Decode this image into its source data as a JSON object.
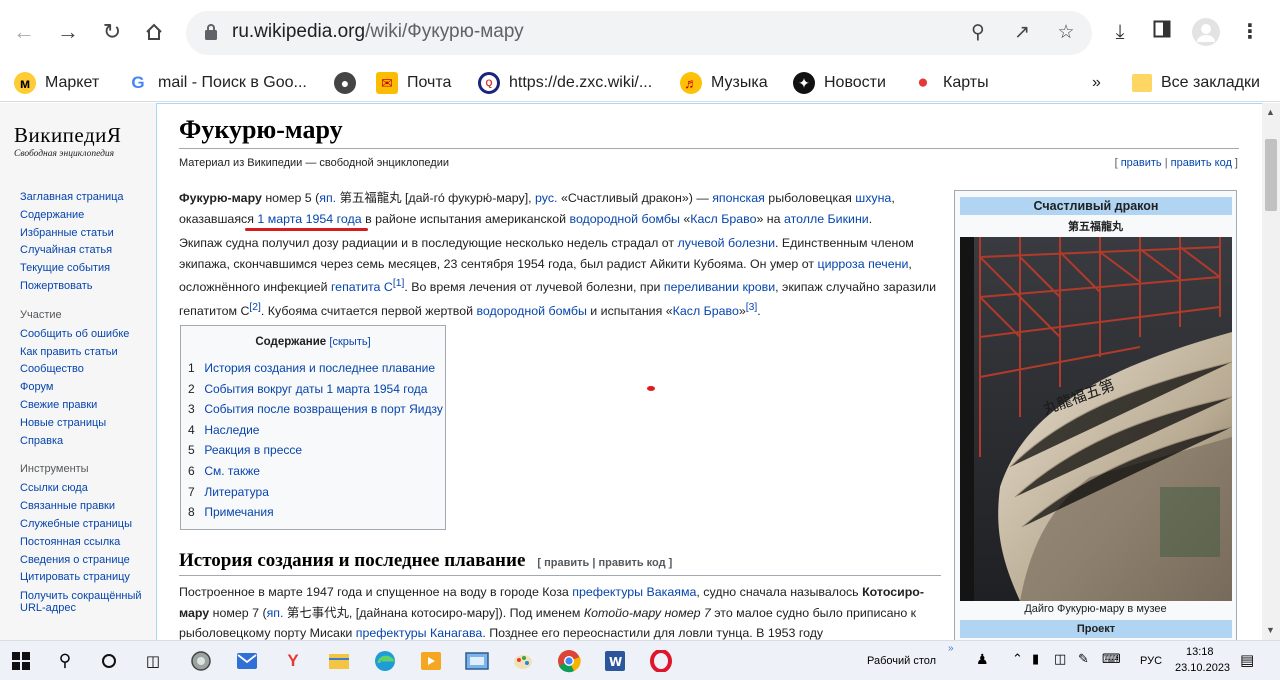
{
  "browser": {
    "url_domain": "ru.wikipedia.org",
    "url_path": "/wiki/Фукурю-мару",
    "bookmarks": [
      "Маркет",
      "mail - Поиск в Goo...",
      "Почта",
      "https://de.zxc.wiki/...",
      "Музыка",
      "Новости",
      "Карты"
    ],
    "more": "»",
    "all_bookmarks": "Все закладки"
  },
  "logo": {
    "name": "ВикипедиЯ",
    "subtitle": "Свободная энциклопедия"
  },
  "sidebar": {
    "nav": [
      "Заглавная страница",
      "Содержание",
      "Избранные статьи",
      "Случайная статья",
      "Текущие события",
      "Пожертвовать"
    ],
    "participation_head": "Участие",
    "participation": [
      "Сообщить об ошибке",
      "Как править статьи",
      "Сообщество",
      "Форум",
      "Свежие правки",
      "Новые страницы",
      "Справка"
    ],
    "tools_head": "Инструменты",
    "tools": [
      "Ссылки сюда",
      "Связанные правки",
      "Служебные страницы",
      "Постоянная ссылка",
      "Сведения о странице",
      "Цитировать страницу",
      "Получить сокращённый URL-адрес"
    ]
  },
  "article": {
    "title": "Фукурю-мару",
    "tagline": "Материал из Википедии — свободной энциклопедии",
    "edit": "править",
    "edit_code": "править код",
    "p1": {
      "bold": "Фукурю-мару",
      "t1": " номер 5 (",
      "l1": "яп.",
      "t2": " 第五福龍丸 [дай-го́ фукурю́-мару], ",
      "l2": "рус.",
      "t3": " «Счастливый дракон») — ",
      "l3": "японская",
      "t4": " рыболовецкая ",
      "l4": "шхуна",
      "t5": ", оказавшаяся ",
      "l5": "1 марта 1954 года",
      "t6": " в районе испытания американской ",
      "l6": "водородной бомбы",
      "t7": " «",
      "l7": "Касл Браво",
      "t8": "» на ",
      "l8": "атолле Бикини",
      "t9": "."
    },
    "p2": {
      "t1": "Экипаж судна получил дозу радиации и в последующие несколько недель страдал от ",
      "l1": "лучевой болезни",
      "t2": ". Единственным членом экипажа, скончавшимся через семь месяцев, 23 сентября 1954 года, был радист Айкити Кубояма. Он умер от ",
      "l2": "цирроза печени",
      "t3": ", осложнённого инфекцией ",
      "l3": "гепатита C",
      "r1": "[1]",
      "t4": ". Во время лечения от лучевой болезни, при ",
      "l4": "переливании крови",
      "t5": ", экипаж случайно заразили гепатитом С",
      "r2": "[2]",
      "t6": ". Кубояма считается первой жертвой ",
      "l5": "водородной бомбы",
      "t7": " и испытания «",
      "l6": "Касл Браво",
      "t8": "»",
      "r3": "[3]",
      "t9": "."
    },
    "toc": {
      "title": "Содержание",
      "hide": "[скрыть]",
      "items": [
        {
          "num": "1",
          "label": "История создания и последнее плавание"
        },
        {
          "num": "2",
          "label": "События вокруг даты 1 марта 1954 года"
        },
        {
          "num": "3",
          "label": "События после возвращения в порт Яидзу"
        },
        {
          "num": "4",
          "label": "Наследие"
        },
        {
          "num": "5",
          "label": "Реакция в прессе"
        },
        {
          "num": "6",
          "label": "См. также"
        },
        {
          "num": "7",
          "label": "Литература"
        },
        {
          "num": "8",
          "label": "Примечания"
        }
      ]
    },
    "section1": {
      "heading": "История создания и последнее плавание",
      "edit_bracket": "[ править | править код ]"
    },
    "p3": {
      "t1": "Построенное в марте 1947 года и спущенное на воду в городе Коза ",
      "l1": "префектуры Вакаяма",
      "t2": ", судно сначала называлось ",
      "b1": "Котосиро-мару",
      "t3": " номер 7 (",
      "l2": "яп.",
      "t4": " 第七事代丸, [дайнана котосиро-мару]). Под именем ",
      "i1": "Котойо-мару номер 7",
      "t5": " это малое судно было приписано к рыболовецкому порту Мисаки ",
      "l3": "префектуры Канагава",
      "t6": ". Позднее его переоснастили для ловли тунца. В 1953 году"
    }
  },
  "infobox": {
    "title": "Счастливый дракон",
    "subtitle": "第五福龍丸",
    "caption": "Дайго Фукурю-мару в музее",
    "section": "Проект",
    "hull_text": "丸龍福五第"
  },
  "taskbar": {
    "desktop": "Рабочий стол",
    "lang": "РУС",
    "time": "13:18",
    "date": "23.10.2023"
  }
}
